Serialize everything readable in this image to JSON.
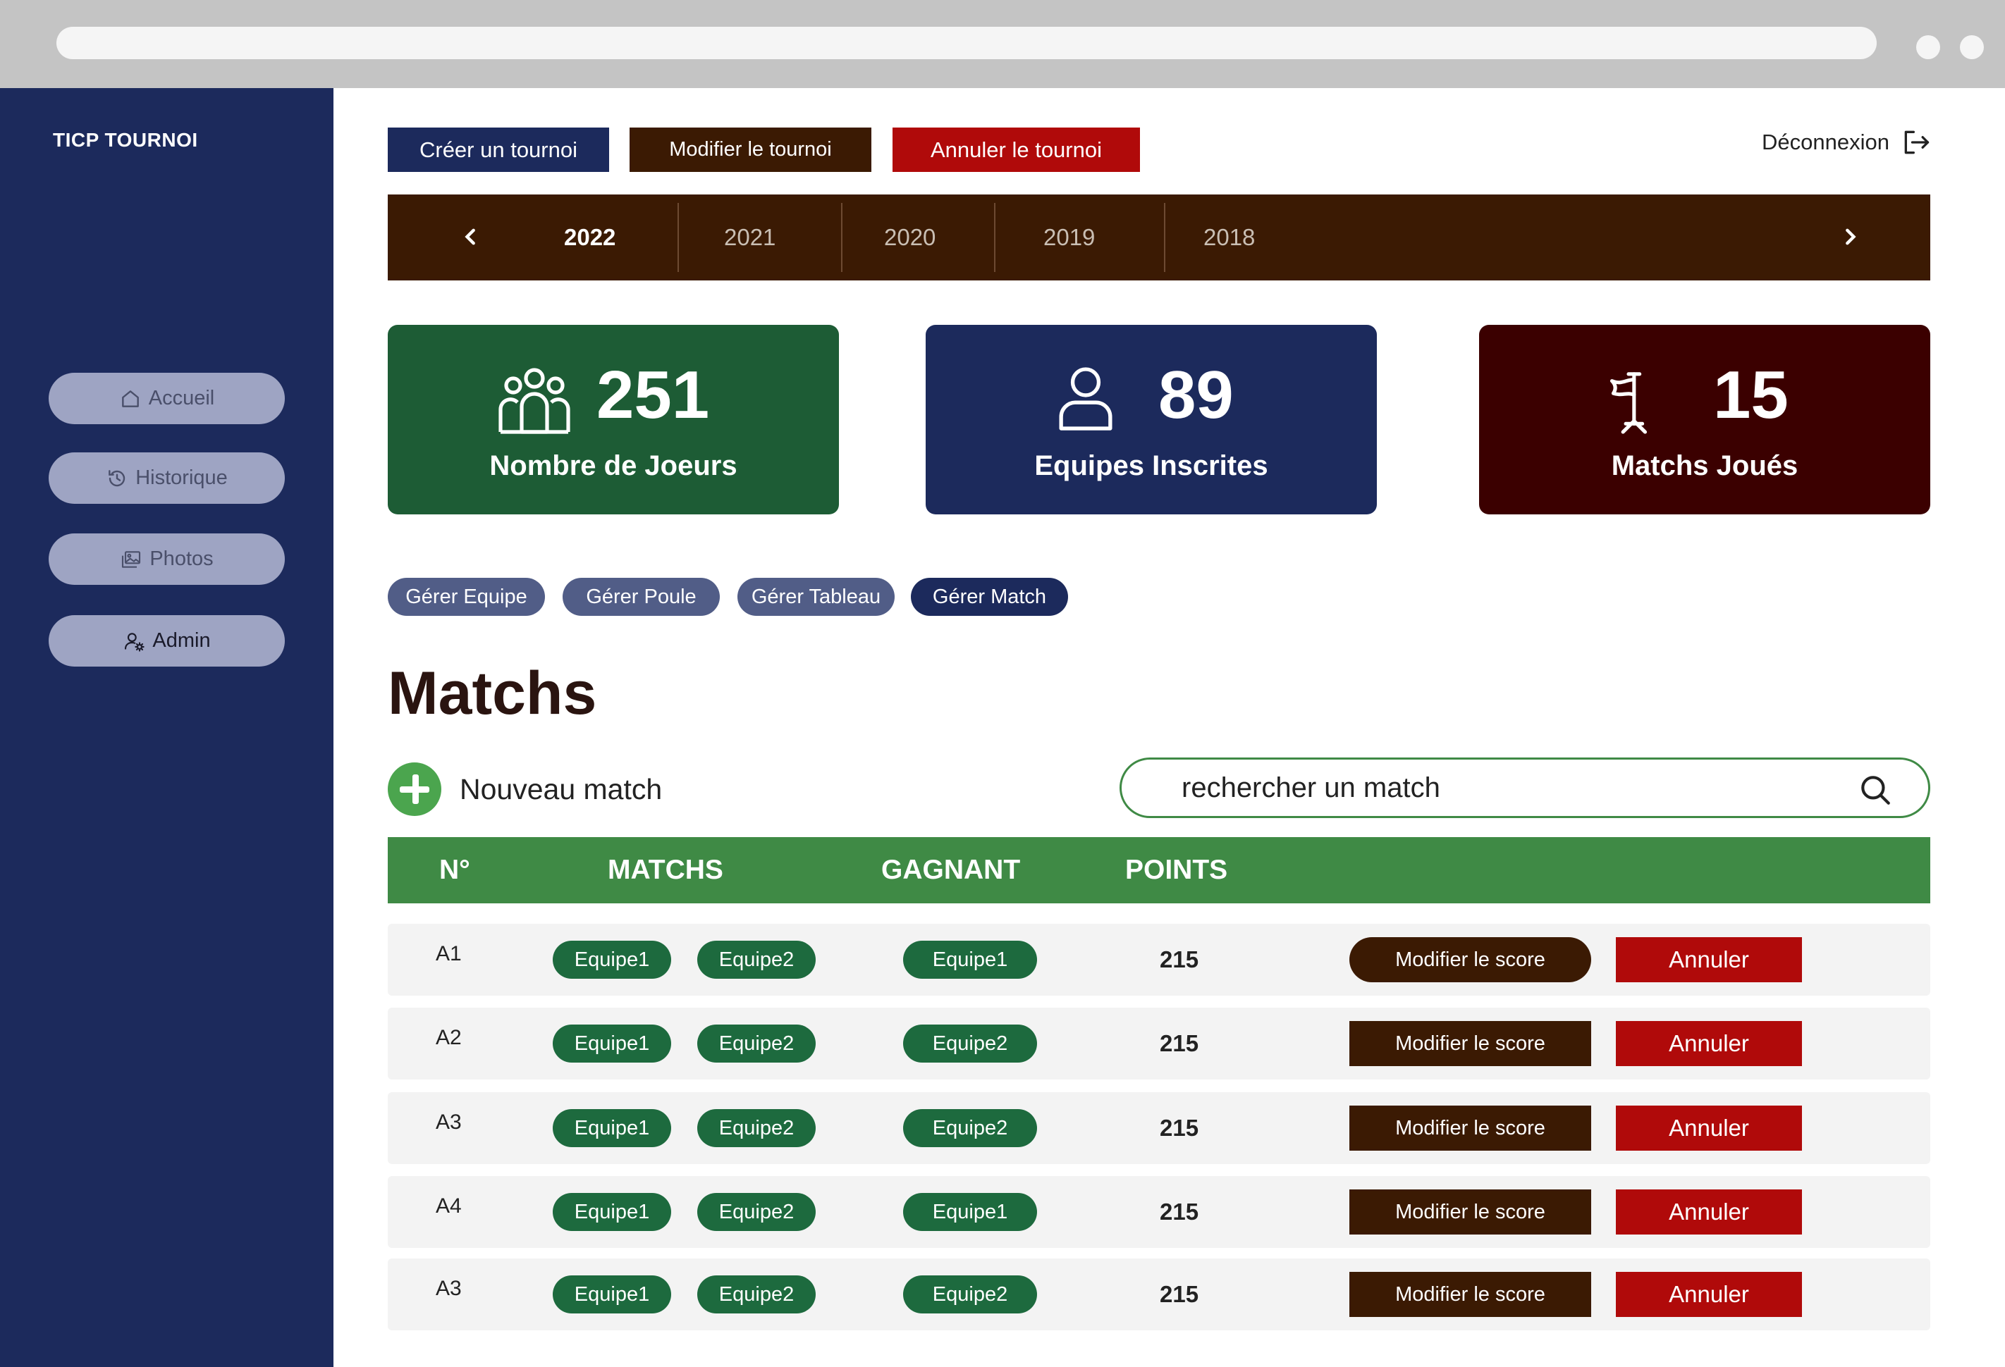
{
  "app": {
    "brand": "TICP TOURNOI"
  },
  "sidebar": {
    "items": [
      {
        "label": "Accueil",
        "icon": "home-icon"
      },
      {
        "label": "Historique",
        "icon": "history-icon"
      },
      {
        "label": "Photos",
        "icon": "photos-icon"
      },
      {
        "label": "Admin",
        "icon": "admin-user-gear-icon",
        "active": true
      }
    ]
  },
  "toolbar": {
    "create_label": "Créer un tournoi",
    "modify_label": "Modifier le tournoi",
    "cancel_label": "Annuler le tournoi",
    "logout_label": "Déconnexion"
  },
  "years": {
    "items": [
      "2022",
      "2021",
      "2020",
      "2019",
      "2018"
    ],
    "selected": "2022"
  },
  "stats": [
    {
      "value": "251",
      "label": "Nombre de Joeurs",
      "color": "#1d5c35",
      "icon": "group-icon"
    },
    {
      "value": "89",
      "label": "Equipes Inscrites",
      "color": "#1c2a5c",
      "icon": "user-icon"
    },
    {
      "value": "15",
      "label": "Matchs Joués",
      "color": "#3b0000",
      "icon": "flag-icon"
    }
  ],
  "filters": {
    "items": [
      "Gérer Equipe",
      "Gérer Poule",
      "Gérer Tableau",
      "Gérer Match"
    ],
    "active": "Gérer Match"
  },
  "page": {
    "title": "Matchs"
  },
  "actions": {
    "new_match_label": "Nouveau match",
    "search_placeholder": "rechercher un match"
  },
  "table": {
    "columns": [
      "N°",
      "MATCHS",
      "GAGNANT",
      "POINTS"
    ],
    "rows": [
      {
        "no": "A1",
        "team1": "Equipe1",
        "team2": "Equipe2",
        "winner": "Equipe1",
        "points": "215",
        "modify": "Modifier le score",
        "cancel": "Annuler"
      },
      {
        "no": "A2",
        "team1": "Equipe1",
        "team2": "Equipe2",
        "winner": "Equipe2",
        "points": "215",
        "modify": "Modifier le score",
        "cancel": "Annuler"
      },
      {
        "no": "A3",
        "team1": "Equipe1",
        "team2": "Equipe2",
        "winner": "Equipe2",
        "points": "215",
        "modify": "Modifier le score",
        "cancel": "Annuler"
      },
      {
        "no": "A4",
        "team1": "Equipe1",
        "team2": "Equipe2",
        "winner": "Equipe1",
        "points": "215",
        "modify": "Modifier le score",
        "cancel": "Annuler"
      },
      {
        "no": "A3",
        "team1": "Equipe1",
        "team2": "Equipe2",
        "winner": "Equipe2",
        "points": "215",
        "modify": "Modifier le score",
        "cancel": "Annuler"
      }
    ]
  },
  "colors": {
    "sidebar": "#1c2a5c",
    "year_bar": "#3b1a03",
    "table_header": "#3f8a45",
    "team_tag": "#1d6a3e",
    "cancel_red": "#b00a0a"
  }
}
